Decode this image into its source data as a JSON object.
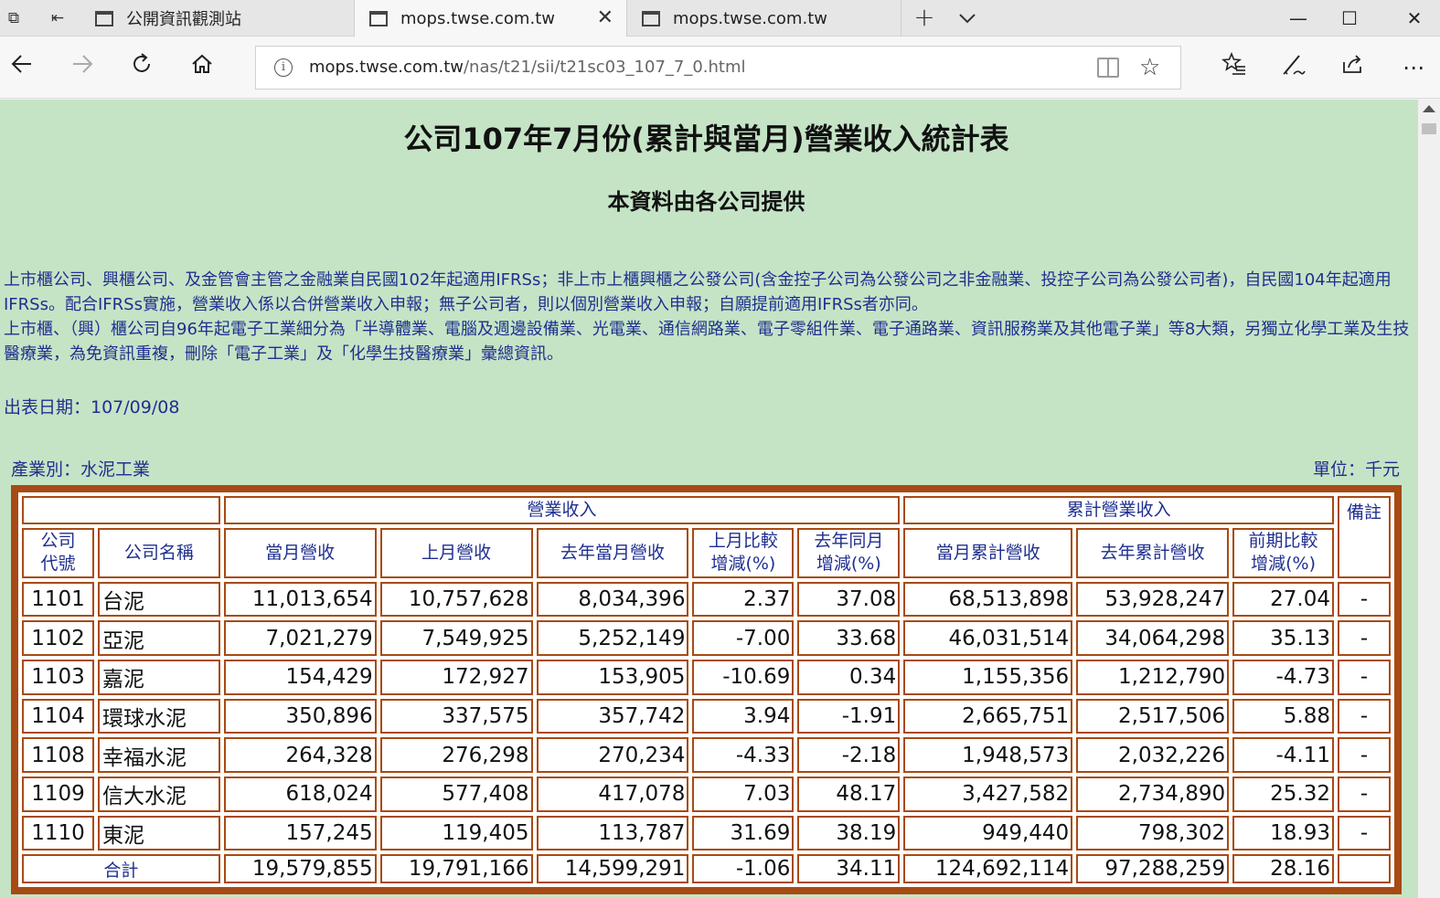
{
  "browser": {
    "tabs": [
      {
        "title": "公開資訊觀測站",
        "active": false
      },
      {
        "title": "mops.twse.com.tw",
        "active": true
      },
      {
        "title": "mops.twse.com.tw",
        "active": false
      }
    ],
    "url_host": "mops.twse.com.tw",
    "url_path": "/nas/t21/sii/t21sc03_107_7_0.html"
  },
  "page": {
    "title": "公司107年7月份(累計與當月)營業收入統計表",
    "subtitle": "本資料由各公司提供",
    "note_line1": "上市櫃公司、興櫃公司、及金管會主管之金融業自民國102年起適用IFRSs；非上市上櫃興櫃之公發公司(含金控子公司為公發公司之非金融業、投控子公司為公發公司者)，自民國104年起適用IFRSs。配合IFRSs實施，營業收入係以合併營業收入申報；無子公司者，則以個別營業收入申報；自願提前適用IFRSs者亦同。",
    "note_line2": "上市櫃、（興）櫃公司自96年起電子工業細分為「半導體業、電腦及週邊設備業、光電業、通信網路業、電子零組件業、電子通路業、資訊服務業及其他電子業」等8大類，另獨立化學工業及生技醫療業，為免資訊重複，刪除「電子工業」及「化學生技醫療業」彙總資訊。",
    "pub_date": "出表日期：107/09/08",
    "industry": "產業別：水泥工業",
    "unit": "單位：千元"
  },
  "table": {
    "group_revenue": "營業收入",
    "group_cumulative": "累計營業收入",
    "col_remark": "備註",
    "col_code": "公司\n代號",
    "col_name": "公司名稱",
    "col_month": "當月營收",
    "col_prev_month": "上月營收",
    "col_last_year_month": "去年當月營收",
    "col_mom": "上月比較\n增減(%)",
    "col_yoy": "去年同月\n增減(%)",
    "col_cum": "當月累計營收",
    "col_last_cum": "去年累計營收",
    "col_cum_change": "前期比較\n增減(%)",
    "rows": [
      {
        "code": "1101",
        "name": "台泥",
        "month": "11,013,654",
        "prev": "10,757,628",
        "ly": "8,034,396",
        "mom": "2.37",
        "yoy": "37.08",
        "cum": "68,513,898",
        "lycum": "53,928,247",
        "cumchg": "27.04",
        "remark": "-"
      },
      {
        "code": "1102",
        "name": "亞泥",
        "month": "7,021,279",
        "prev": "7,549,925",
        "ly": "5,252,149",
        "mom": "-7.00",
        "yoy": "33.68",
        "cum": "46,031,514",
        "lycum": "34,064,298",
        "cumchg": "35.13",
        "remark": "-"
      },
      {
        "code": "1103",
        "name": "嘉泥",
        "month": "154,429",
        "prev": "172,927",
        "ly": "153,905",
        "mom": "-10.69",
        "yoy": "0.34",
        "cum": "1,155,356",
        "lycum": "1,212,790",
        "cumchg": "-4.73",
        "remark": "-"
      },
      {
        "code": "1104",
        "name": "環球水泥",
        "month": "350,896",
        "prev": "337,575",
        "ly": "357,742",
        "mom": "3.94",
        "yoy": "-1.91",
        "cum": "2,665,751",
        "lycum": "2,517,506",
        "cumchg": "5.88",
        "remark": "-"
      },
      {
        "code": "1108",
        "name": "幸福水泥",
        "month": "264,328",
        "prev": "276,298",
        "ly": "270,234",
        "mom": "-4.33",
        "yoy": "-2.18",
        "cum": "1,948,573",
        "lycum": "2,032,226",
        "cumchg": "-4.11",
        "remark": "-"
      },
      {
        "code": "1109",
        "name": "信大水泥",
        "month": "618,024",
        "prev": "577,408",
        "ly": "417,078",
        "mom": "7.03",
        "yoy": "48.17",
        "cum": "3,427,582",
        "lycum": "2,734,890",
        "cumchg": "25.32",
        "remark": "-"
      },
      {
        "code": "1110",
        "name": "東泥",
        "month": "157,245",
        "prev": "119,405",
        "ly": "113,787",
        "mom": "31.69",
        "yoy": "38.19",
        "cum": "949,440",
        "lycum": "798,302",
        "cumchg": "18.93",
        "remark": "-"
      }
    ],
    "total": {
      "label": "合計",
      "month": "19,579,855",
      "prev": "19,791,166",
      "ly": "14,599,291",
      "mom": "-1.06",
      "yoy": "34.11",
      "cum": "124,692,114",
      "lycum": "97,288,259",
      "cumchg": "28.16",
      "remark": ""
    }
  }
}
